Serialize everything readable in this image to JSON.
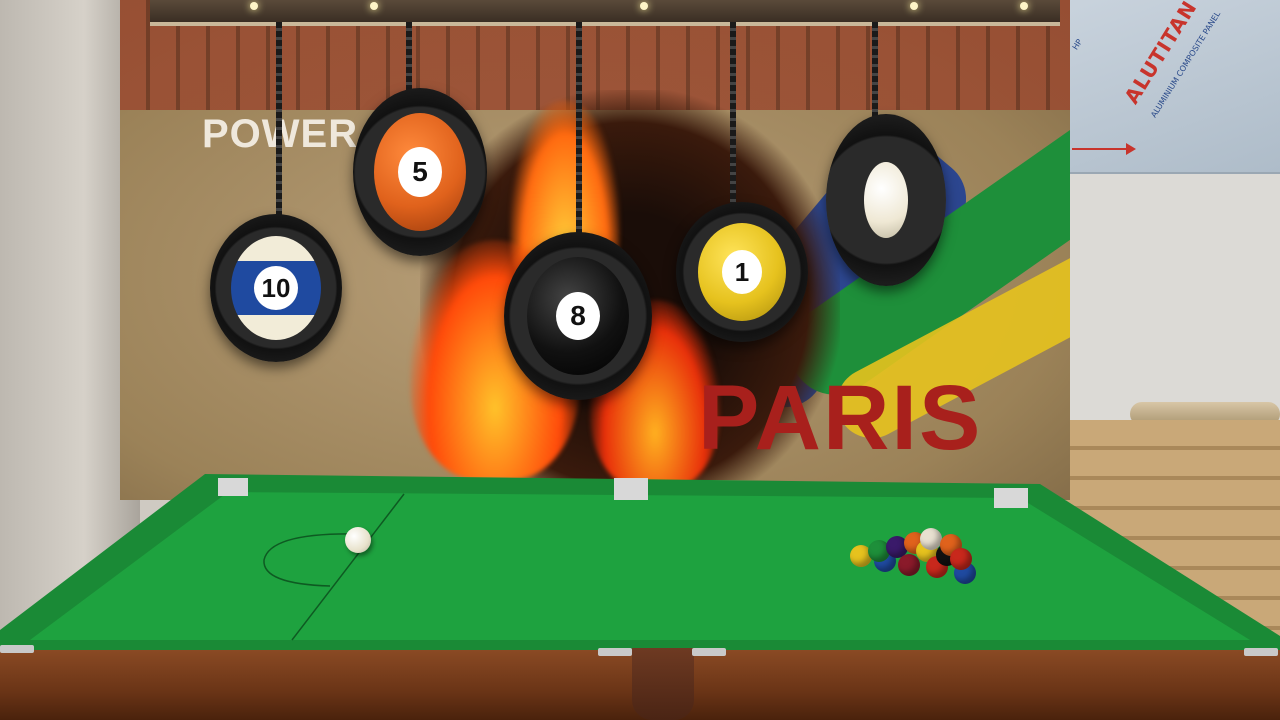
{
  "scene": {
    "description_labels": {
      "mural_word_top": "POWER",
      "mural_word_bottom": "PARIS"
    },
    "wall_panel": {
      "brand_name": "ALUTITAN",
      "brand_prefix": "HP",
      "brand_subtitle": "ALUMINIUM COMPOSITE PANEL"
    },
    "hanging_balls": [
      {
        "number": "10",
        "color": "#1f4aa0",
        "style": "stripe"
      },
      {
        "number": "5",
        "color": "#e0621c",
        "style": "solid"
      },
      {
        "number": "8",
        "color": "#111111",
        "style": "solid"
      },
      {
        "number": "1",
        "color": "#e6c21e",
        "style": "solid"
      },
      {
        "number": "",
        "color": "#efe8d4",
        "style": "cue"
      }
    ],
    "colors": {
      "cloth": "#1e9a3e",
      "rail": "#1a8a36",
      "wood": "#7a3e1c",
      "flame": "#ff5a10"
    }
  }
}
